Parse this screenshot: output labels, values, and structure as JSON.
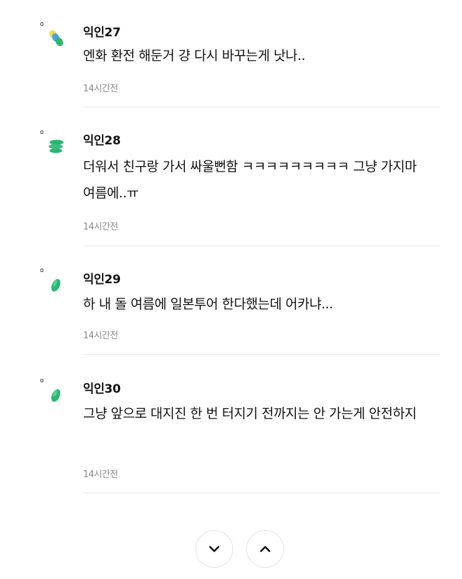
{
  "comments": [
    {
      "author": "익인27",
      "text": "엔화 환전 해둔거 걍 다시 바꾸는게 낫나..",
      "time": "14시간전",
      "avatar_icon": "avatar-blob-yellow-blue-green"
    },
    {
      "author": "익인28",
      "text": "더워서 친구랑 가서 싸울뻔함 ㅋㅋㅋㅋㅋㅋㅋㅋㅋ 그냥 가지마 여름에..ㅠ",
      "time": "14시간전",
      "avatar_icon": "avatar-blob-green-stack"
    },
    {
      "author": "익인29",
      "text": "하 내 돌 여름에 일본투어 한다했는데 어카냐...",
      "time": "14시간전",
      "avatar_icon": "avatar-blob-green-leaf"
    },
    {
      "author": "익인30",
      "text": "그냥 앞으로 대지진 한 번 터지기 전까지는 안 가는게 안전하지",
      "time": "14시간전",
      "avatar_icon": "avatar-blob-green-leaf"
    }
  ],
  "pagination": {
    "down_icon": "chevron-down-icon",
    "up_icon": "chevron-up-icon"
  },
  "colors": {
    "author": "#111111",
    "body_text": "#111111",
    "timestamp": "#8a8a8a",
    "divider": "#e9e9e9",
    "avatar_green": "#2bb673",
    "avatar_blue": "#4aa3df",
    "avatar_yellow": "#f2d94e"
  }
}
